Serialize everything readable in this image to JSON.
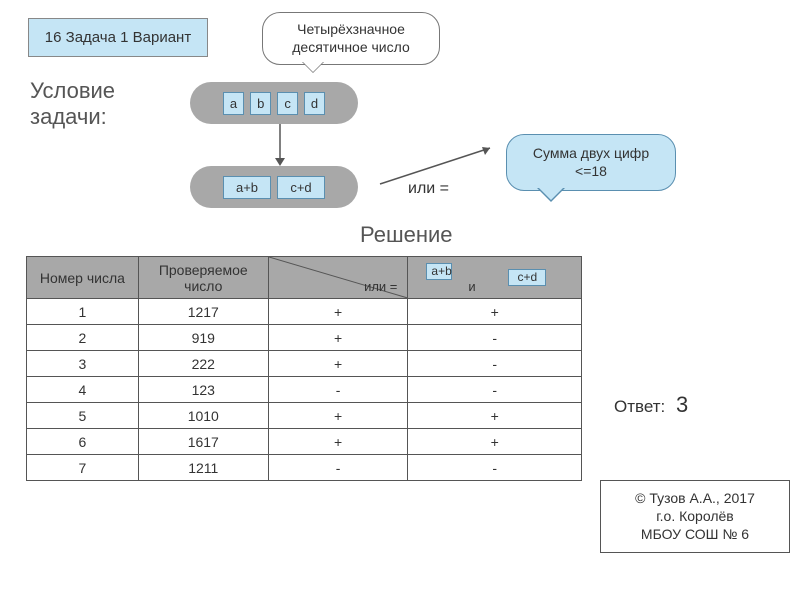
{
  "title": "16 Задача 1 Вариант",
  "callout_top": "Четырёхзначное десятичное число",
  "condition_label": "Условие\nзадачи:",
  "digits": [
    "a",
    "b",
    "c",
    "d"
  ],
  "sums": [
    "a+b",
    "c+d"
  ],
  "ili_eq": "или =",
  "callout_sum": "Сумма двух цифр <=18",
  "solution_label": "Решение",
  "headers": {
    "c1": "Номер числа",
    "c2": "Проверяемое число",
    "c3_ili": "или  =",
    "c4_ab": "a+b",
    "c4_cd": "c+d",
    "c4_and": "и"
  },
  "rows": [
    {
      "n": "1",
      "num": "1217",
      "c3": "+",
      "c4": "+"
    },
    {
      "n": "2",
      "num": "919",
      "c3": "+",
      "c4": "-"
    },
    {
      "n": "3",
      "num": "222",
      "c3": "+",
      "c4": "-"
    },
    {
      "n": "4",
      "num": "123",
      "c3": "-",
      "c4": "-"
    },
    {
      "n": "5",
      "num": "1010",
      "c3": "+",
      "c4": "+"
    },
    {
      "n": "6",
      "num": "1617",
      "c3": "+",
      "c4": "+"
    },
    {
      "n": "7",
      "num": "1211",
      "c3": "-",
      "c4": "-"
    }
  ],
  "answer_label": "Ответ:",
  "answer_value": "3",
  "credit": "© Тузов А.А., 2017\nг.о. Королёв\nМБОУ СОШ № 6"
}
